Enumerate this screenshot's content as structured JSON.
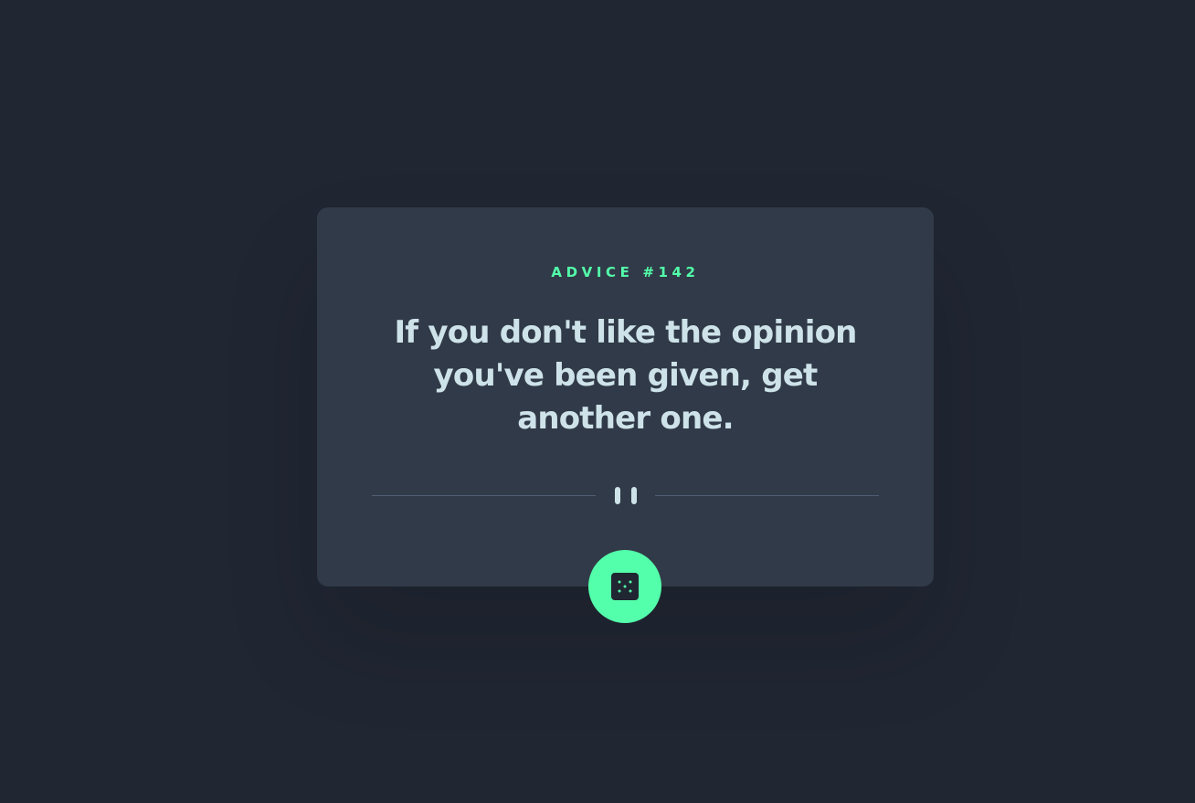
{
  "advice": {
    "id_label": "ADVICE #142",
    "quote": "If you don't like the opinion you've been given, get another one."
  },
  "colors": {
    "background": "#202632",
    "card": "#313a48",
    "accent": "#53ffaa",
    "text": "#cee3e9",
    "divider": "#4f5d74"
  },
  "icons": {
    "divider": "pause-icon",
    "button": "dice-icon"
  }
}
